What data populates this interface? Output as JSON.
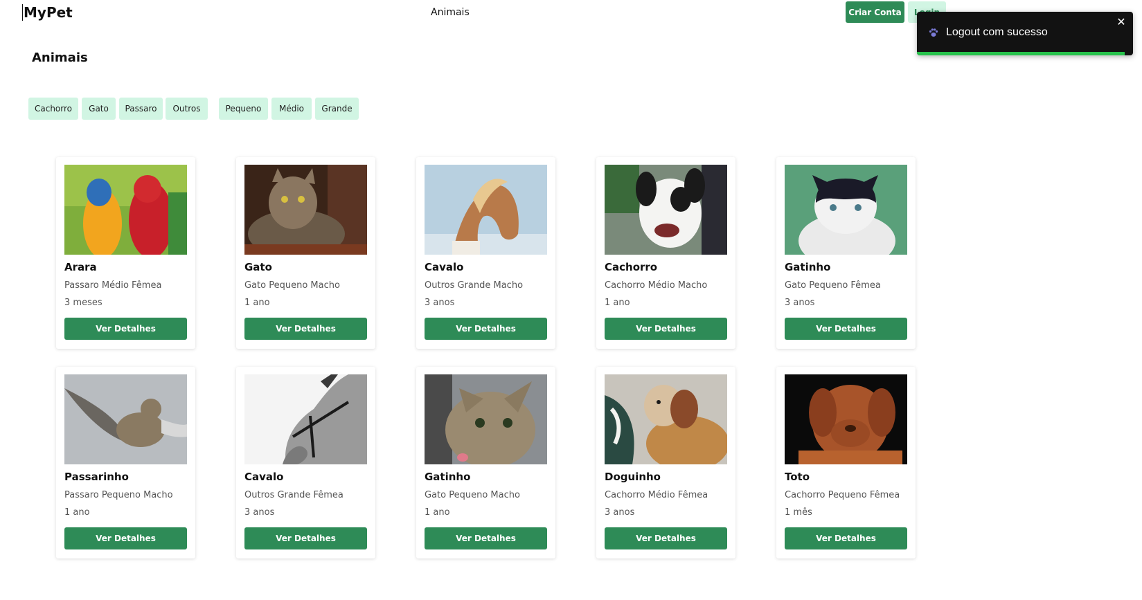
{
  "header": {
    "brand": "MyPet",
    "nav_animals": "Animais",
    "create_account": "Criar Conta",
    "login": "Login"
  },
  "toast": {
    "icon": "paw-icon",
    "message": "Logout com sucesso",
    "close_label": "✕",
    "progress": 0.96,
    "colors": {
      "background": "#121212",
      "progress": "#27c24c"
    }
  },
  "page": {
    "title": "Animais"
  },
  "filters": {
    "species": [
      "Cachorro",
      "Gato",
      "Passaro",
      "Outros"
    ],
    "sizes": [
      "Pequeno",
      "Médio",
      "Grande"
    ]
  },
  "animals": [
    {
      "name": "Arara",
      "desc": "Passaro Médio Fêmea",
      "age": "3 meses",
      "button": "Ver Detalhes"
    },
    {
      "name": "Gato",
      "desc": "Gato Pequeno Macho",
      "age": "1 ano",
      "button": "Ver Detalhes"
    },
    {
      "name": "Cavalo",
      "desc": "Outros Grande Macho",
      "age": "3 anos",
      "button": "Ver Detalhes"
    },
    {
      "name": "Cachorro",
      "desc": "Cachorro Médio Macho",
      "age": "1 ano",
      "button": "Ver Detalhes"
    },
    {
      "name": "Gatinho",
      "desc": "Gato Pequeno Fêmea",
      "age": "3 anos",
      "button": "Ver Detalhes"
    },
    {
      "name": "Passarinho",
      "desc": "Passaro Pequeno Macho",
      "age": "1 ano",
      "button": "Ver Detalhes"
    },
    {
      "name": "Cavalo",
      "desc": "Outros Grande Fêmea",
      "age": "3 anos",
      "button": "Ver Detalhes"
    },
    {
      "name": "Gatinho",
      "desc": "Gato Pequeno Macho",
      "age": "1 ano",
      "button": "Ver Detalhes"
    },
    {
      "name": "Doguinho",
      "desc": "Cachorro Médio Fêmea",
      "age": "3 anos",
      "button": "Ver Detalhes"
    },
    {
      "name": "Toto",
      "desc": "Cachorro Pequeno Fêmea",
      "age": "1 mês",
      "button": "Ver Detalhes"
    }
  ],
  "colors": {
    "primary": "#2e8b57",
    "chip": "#d1f5e3"
  }
}
